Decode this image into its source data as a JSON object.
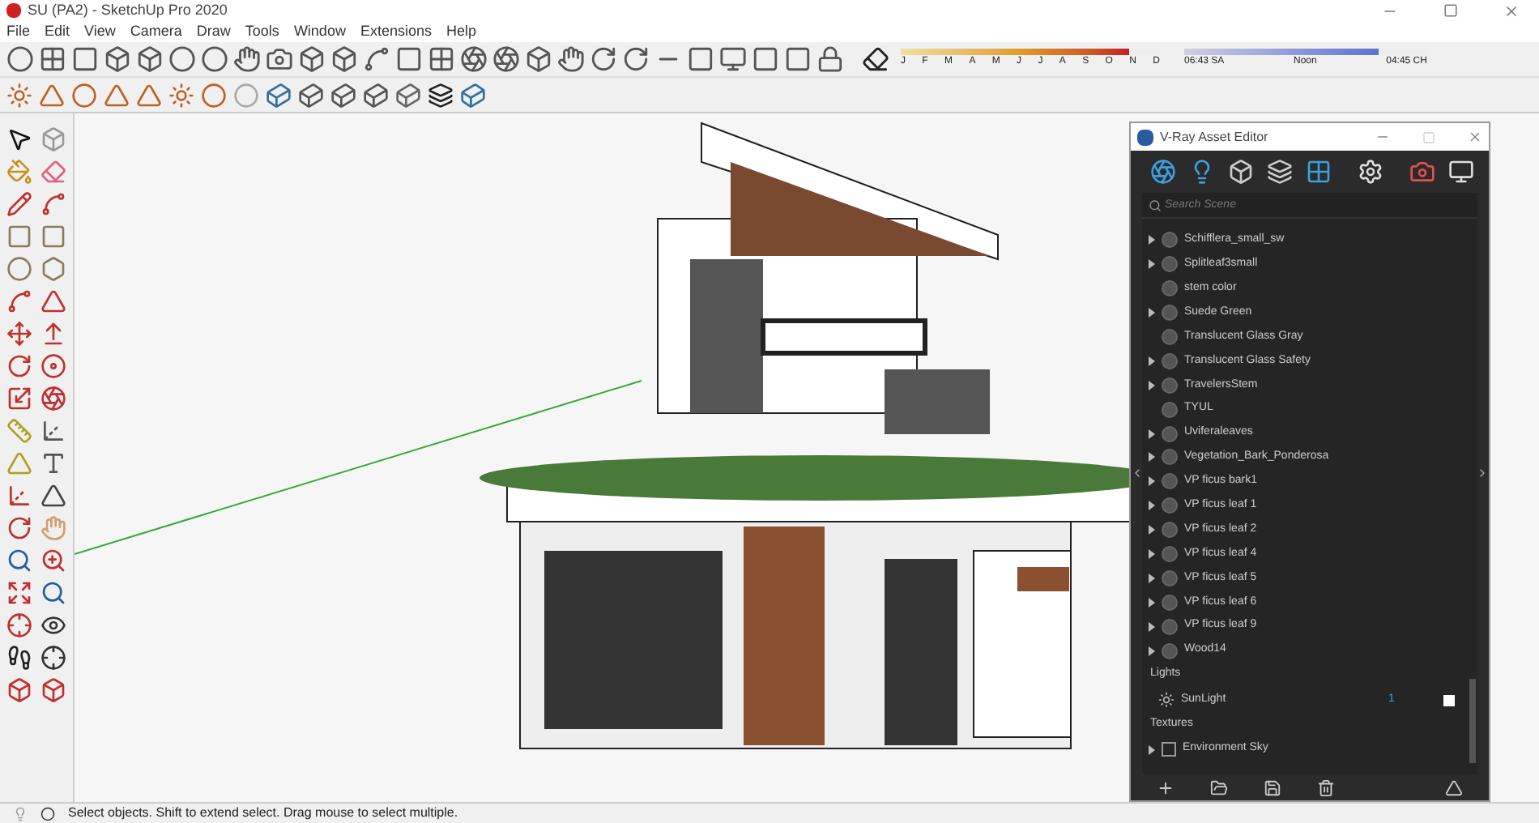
{
  "window": {
    "title": "SU (PA2) - SketchUp Pro 2020"
  },
  "menu": [
    "File",
    "Edit",
    "View",
    "Camera",
    "Draw",
    "Tools",
    "Window",
    "Extensions",
    "Help"
  ],
  "shadow_settings": {
    "months": [
      "J",
      "F",
      "M",
      "A",
      "M",
      "J",
      "J",
      "A",
      "S",
      "O",
      "N",
      "D"
    ],
    "time_start": "06:43 SA",
    "time_mid": "Noon",
    "time_end": "04:45 CH",
    "date_slider": {
      "level": 0.88
    },
    "time_slider": {
      "level": 0.8
    }
  },
  "vray_editor": {
    "title": "V-Ray Asset Editor",
    "search": {
      "placeholder": "Search Scene"
    },
    "materials": [
      {
        "name": "Schifflera_small_sw",
        "expandable": true
      },
      {
        "name": "Splitleaf3small",
        "expandable": true
      },
      {
        "name": "stem color",
        "expandable": false
      },
      {
        "name": "Suede Green",
        "expandable": true
      },
      {
        "name": "Translucent Glass Gray",
        "expandable": false
      },
      {
        "name": "Translucent Glass Safety",
        "expandable": true
      },
      {
        "name": "TravelersStem",
        "expandable": true
      },
      {
        "name": "TYUL",
        "expandable": false
      },
      {
        "name": "Uviferaleaves",
        "expandable": true
      },
      {
        "name": "Vegetation_Bark_Ponderosa",
        "expandable": true
      },
      {
        "name": "VP ficus bark1",
        "expandable": true
      },
      {
        "name": "VP ficus leaf 1",
        "expandable": true
      },
      {
        "name": "VP ficus leaf 2",
        "expandable": true
      },
      {
        "name": "VP ficus leaf 4",
        "expandable": true
      },
      {
        "name": "VP ficus leaf 5",
        "expandable": true
      },
      {
        "name": "VP ficus leaf 6",
        "expandable": true
      },
      {
        "name": "VP ficus leaf 9",
        "expandable": true
      },
      {
        "name": "Wood14",
        "expandable": true
      }
    ],
    "lights_heading": "Lights",
    "lights": [
      {
        "name": "SunLight",
        "count": "1",
        "enabled": true
      }
    ],
    "textures_heading": "Textures",
    "textures": [
      {
        "name": "Environment Sky",
        "expandable": true
      }
    ]
  },
  "status_bar": {
    "message": "Select objects. Shift to extend select. Drag mouse to select multiple."
  }
}
